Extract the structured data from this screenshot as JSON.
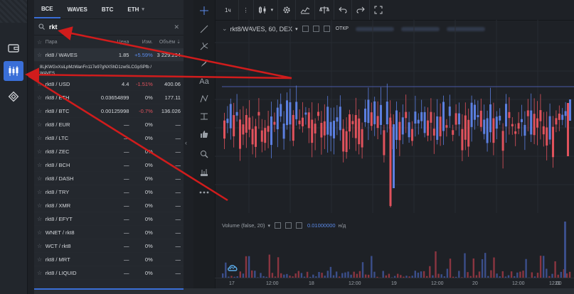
{
  "tabs": [
    "ВСЕ",
    "WAVES",
    "BTC",
    "ETH"
  ],
  "search": {
    "value": "rkt"
  },
  "table": {
    "headers": {
      "pair": "Пара",
      "price": "Цена",
      "change": "Изм.",
      "volume": "Объём"
    },
    "rows": [
      {
        "pair": "rkt8 / WAVES",
        "price": "1.85",
        "change": "+5.59%",
        "volume": "3 229.294",
        "dir": "pos",
        "highlight": true
      },
      {
        "pair": "rkt8 / USD",
        "price": "4.4",
        "change": "-1.51%",
        "volume": "400.06",
        "dir": "neg"
      },
      {
        "pair": "rkt8 / ETH",
        "price": "0.03654899",
        "change": "0%",
        "volume": "177.11",
        "dir": ""
      },
      {
        "pair": "rkt8 / BTC",
        "price": "0.00125998",
        "change": "-0.7%",
        "volume": "136.026",
        "dir": "neg"
      },
      {
        "pair": "rkt8 / EUR",
        "price": "—",
        "change": "0%",
        "volume": "—",
        "dir": ""
      },
      {
        "pair": "rkt8 / LTC",
        "price": "—",
        "change": "0%",
        "volume": "—",
        "dir": ""
      },
      {
        "pair": "rkt8 / ZEC",
        "price": "—",
        "change": "0%",
        "volume": "—",
        "dir": ""
      },
      {
        "pair": "rkt8 / BCH",
        "price": "—",
        "change": "0%",
        "volume": "—",
        "dir": ""
      },
      {
        "pair": "rkt8 / DASH",
        "price": "—",
        "change": "0%",
        "volume": "—",
        "dir": ""
      },
      {
        "pair": "rkt8 / TRY",
        "price": "—",
        "change": "0%",
        "volume": "—",
        "dir": ""
      },
      {
        "pair": "rkt8 / XMR",
        "price": "—",
        "change": "0%",
        "volume": "—",
        "dir": ""
      },
      {
        "pair": "rkt8 / EFYT",
        "price": "—",
        "change": "0%",
        "volume": "—",
        "dir": ""
      },
      {
        "pair": "WNET / rkt8",
        "price": "—",
        "change": "0%",
        "volume": "—",
        "dir": ""
      },
      {
        "pair": "WCT / rkt8",
        "price": "—",
        "change": "0%",
        "volume": "—",
        "dir": ""
      },
      {
        "pair": "rkt8 / MRT",
        "price": "—",
        "change": "0%",
        "volume": "—",
        "dir": ""
      },
      {
        "pair": "rkt8 / LIQUID",
        "price": "—",
        "change": "0%",
        "volume": "—",
        "dir": ""
      }
    ],
    "asset_id_line1": "8LjKWGxXsiLpMzWanFn117e97gNXShD1zwSLCGpSPfb /",
    "asset_id_line2": "WAVES"
  },
  "toolbar": {
    "interval": "1ч"
  },
  "chart": {
    "title": "rkt8/WAVES, 60, DEX",
    "open_label": "ОТКР",
    "volume_label": "Volume (false, 20)",
    "volume_value": "0.01000000",
    "volume_suffix": "н/д",
    "x_ticks": [
      "17",
      "12:00",
      "18",
      "12:00",
      "19",
      "12:00",
      "20",
      "12:00",
      "21",
      "12:00"
    ]
  },
  "colors": {
    "up": "#5b7fe0",
    "down": "#e0525c",
    "accent": "#3a6fd8",
    "annotation": "#d11c1c"
  }
}
